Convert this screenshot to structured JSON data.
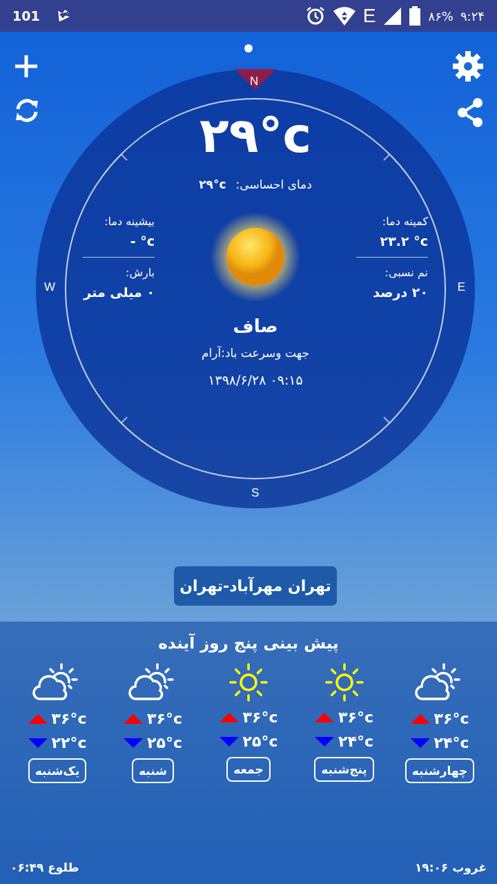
{
  "status_bar": {
    "left_text": "101",
    "network": "E",
    "battery": "۸۶%",
    "time": "۹:۲۴"
  },
  "current": {
    "temperature": "۲۹°c",
    "feels_label": "دمای احساسی:",
    "feels_value": "۲۹°c",
    "max_label": "بیشینه دما:",
    "max_value": "- °c",
    "precip_label": "بارش:",
    "precip_value": "۰ میلی متر",
    "min_label": "کمینه دما:",
    "min_value": "۲۳.۲ °c",
    "humidity_label": "نم نسبی:",
    "humidity_value": "۲۰ درصد",
    "condition": "صاف",
    "wind": "جهت وسرعت باد:آرام",
    "datetime": "۰۹:۱۵ ۱۳۹۸/۶/۲۸"
  },
  "compass": {
    "north": "N",
    "east": "E",
    "south": "S",
    "west": "W"
  },
  "location": "تهران مهرآباد-تهران",
  "forecast": {
    "title": "پیش بینی پنج روز آینده",
    "days": [
      {
        "day": "چهارشنبه",
        "kind": "partly_cloudy",
        "high": "۳۶°c",
        "low": "۲۴°c"
      },
      {
        "day": "پنج‌شنبه",
        "kind": "sunny",
        "high": "۳۶°c",
        "low": "۲۴°c"
      },
      {
        "day": "جمعه",
        "kind": "sunny",
        "high": "۳۶°c",
        "low": "۲۵°c"
      },
      {
        "day": "شنبه",
        "kind": "partly_cloudy",
        "high": "۳۶°c",
        "low": "۲۵°c"
      },
      {
        "day": "یک‌شنبه",
        "kind": "partly_cloudy",
        "high": "۳۶°c",
        "low": "۲۲°c"
      }
    ]
  },
  "sunset": "غروب ۱۹:۰۶",
  "sunrise": "طلوع ۰۶:۴۹"
}
